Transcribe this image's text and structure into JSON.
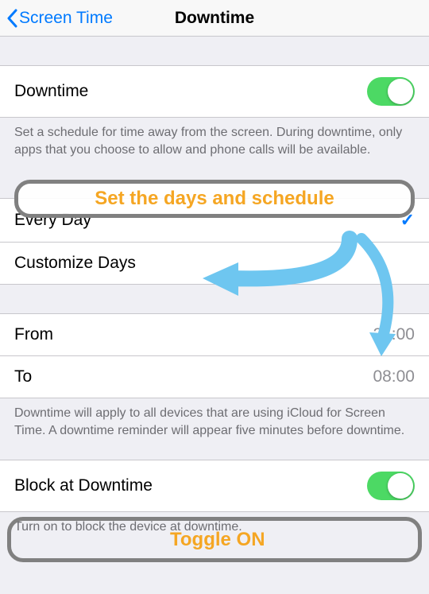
{
  "nav": {
    "back": "Screen Time",
    "title": "Downtime"
  },
  "cells": {
    "downtime_label": "Downtime",
    "downtime_desc": "Set a schedule for time away from the screen. During downtime, only apps that you choose to allow and phone calls will be available.",
    "every_day": "Every Day",
    "customize_days": "Customize Days",
    "from_label": "From",
    "from_value": "21:00",
    "to_label": "To",
    "to_value": "08:00",
    "schedule_desc": "Downtime will apply to all devices that are using iCloud for Screen Time. A downtime reminder will appear five minutes before downtime.",
    "block_label": "Block at Downtime",
    "block_desc": "Turn on to block the device at downtime."
  },
  "toggles": {
    "downtime_on": true,
    "block_on": true
  },
  "annotations": {
    "schedule": "Set the days and schedule",
    "toggle": "Toggle ON"
  },
  "colors": {
    "accent": "#007aff",
    "toggle_on": "#4cd964",
    "anno_text": "#f5a623",
    "arrow": "#6ec6f0"
  }
}
